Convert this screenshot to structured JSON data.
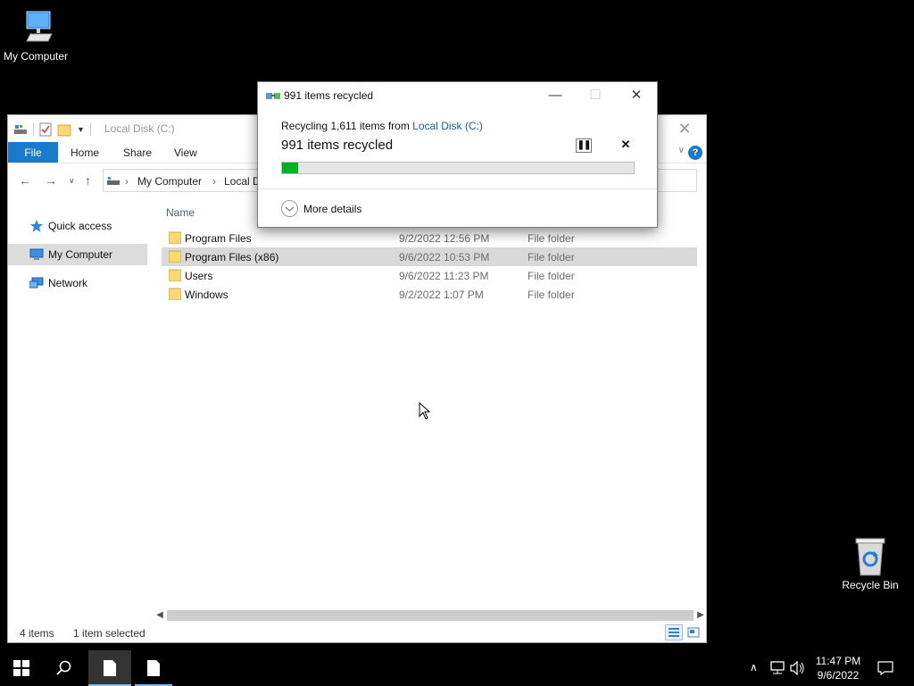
{
  "desktop": {
    "icons": [
      {
        "label": "My Computer"
      },
      {
        "label": "Recycle Bin"
      }
    ]
  },
  "explorer": {
    "title": "Local Disk (C:)",
    "ribbon": {
      "tabs": [
        "File",
        "Home",
        "Share",
        "View"
      ]
    },
    "address": {
      "crumbs": [
        "My Computer",
        "Local D"
      ]
    },
    "sidebar": {
      "items": [
        {
          "label": "Quick access",
          "icon": "star-icon",
          "selected": false
        },
        {
          "label": "My Computer",
          "icon": "computer-icon",
          "selected": true
        },
        {
          "label": "Network",
          "icon": "network-icon",
          "selected": false
        }
      ]
    },
    "columns": {
      "name": "Name"
    },
    "files": [
      {
        "name": "Program Files",
        "date": "9/2/2022 12:56 PM",
        "type": "File folder",
        "selected": false
      },
      {
        "name": "Program Files (x86)",
        "date": "9/6/2022 10:53 PM",
        "type": "File folder",
        "selected": true
      },
      {
        "name": "Users",
        "date": "9/6/2022 11:23 PM",
        "type": "File folder",
        "selected": false
      },
      {
        "name": "Windows",
        "date": "9/2/2022 1:07 PM",
        "type": "File folder",
        "selected": false
      }
    ],
    "status": {
      "count": "4 items",
      "selection": "1 item selected"
    }
  },
  "dialog": {
    "title": "991 items recycled",
    "line_prefix": "Recycling 1,611 items from ",
    "line_link": "Local Disk (C:)",
    "headline": "991 items recycled",
    "progress_fraction": 0.045,
    "more_details": "More details"
  },
  "taskbar": {
    "time": "11:47 PM",
    "date": "9/6/2022"
  },
  "colors": {
    "accent": "#1979ca",
    "progress": "#06b025",
    "folder": "#f8d775"
  }
}
